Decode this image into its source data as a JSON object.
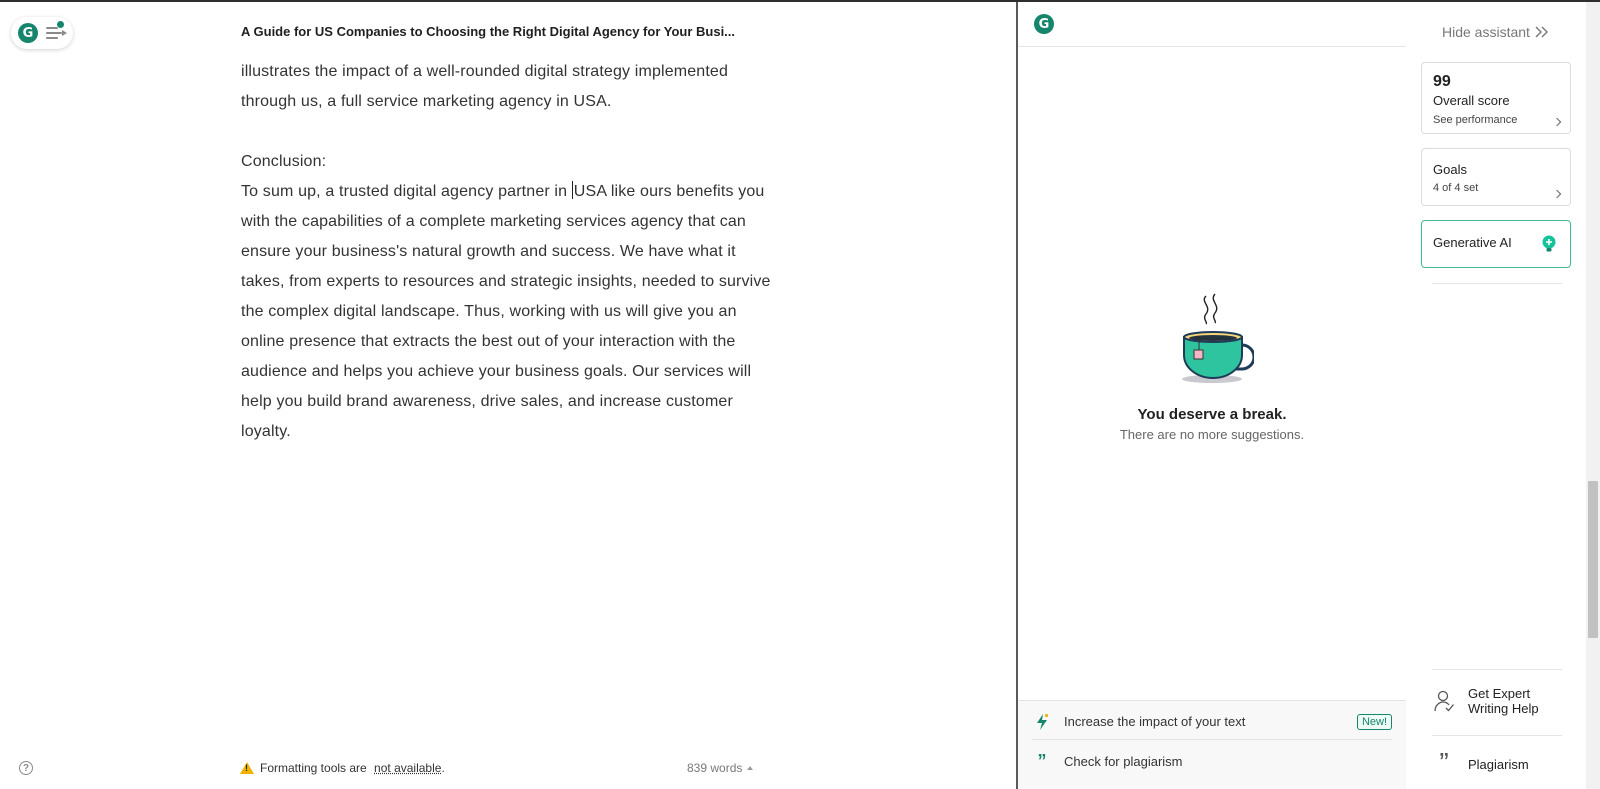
{
  "editor": {
    "title": "A Guide for US Companies to Choosing the Right Digital Agency for Your Busi...",
    "paragraph_top": [
      "illustrates the impact of a well-rounded digital strategy implemented",
      "through us, a full service marketing agency in USA."
    ],
    "conclusion_heading": "Conclusion:",
    "conclusion_first_before_caret": "To sum up, a trusted digital agency partner in ",
    "conclusion_first_after_caret": "USA like ours benefits you",
    "conclusion_lines": [
      "with the capabilities of a complete marketing services agency that can",
      "ensure your business's natural growth and success. We have what it",
      "takes, from experts to resources and strategic insights, needed to survive",
      "the complex digital landscape. Thus, working with us will give you an",
      "online presence that extracts the best out of your interaction with the",
      "audience and helps you achieve your business goals. Our services will",
      "help you build brand awareness, drive sales, and increase customer",
      "loyalty."
    ],
    "format_note_prefix": "Formatting tools are ",
    "format_note_link": "not available",
    "format_note_suffix": ".",
    "word_count": "839 words",
    "help_label": "?"
  },
  "assistant": {
    "empty_title": "You deserve a break.",
    "empty_subtitle": "There are no more suggestions.",
    "footer": {
      "impact_label": "Increase the impact of your text",
      "new_badge": "New!",
      "plagiarism_label": "Check for plagiarism"
    }
  },
  "rail": {
    "hide_label": "Hide assistant",
    "score_value": "99",
    "score_label": "Overall score",
    "score_link": "See performance",
    "goals_label": "Goals",
    "goals_status": "4 of 4 set",
    "genai_label": "Generative AI",
    "expert_label_line1": "Get Expert",
    "expert_label_line2": "Writing Help",
    "plagiarism_label": "Plagiarism"
  },
  "scrollbar": {
    "position": 0.76,
    "visible_fraction": 0.2
  },
  "colors": {
    "brand": "#15866c",
    "accent_border": "#3fb89a",
    "warning": "#f1b300",
    "cup": "#2ec4a0"
  },
  "icons": {
    "brand_logo": "grammarly-g-icon",
    "menu": "menu-icon",
    "help": "help-circle-icon",
    "warning": "warning-triangle-icon",
    "word_count_caret": "caret-up-icon",
    "empty_state": "tea-cup-icon",
    "impact": "lightning-icon",
    "plagiarism_quote": "quote-icon",
    "hide": "double-chevron-right-icon",
    "chevron": "chevron-right-icon",
    "genai": "bulb-plus-icon",
    "expert": "expert-person-icon"
  }
}
